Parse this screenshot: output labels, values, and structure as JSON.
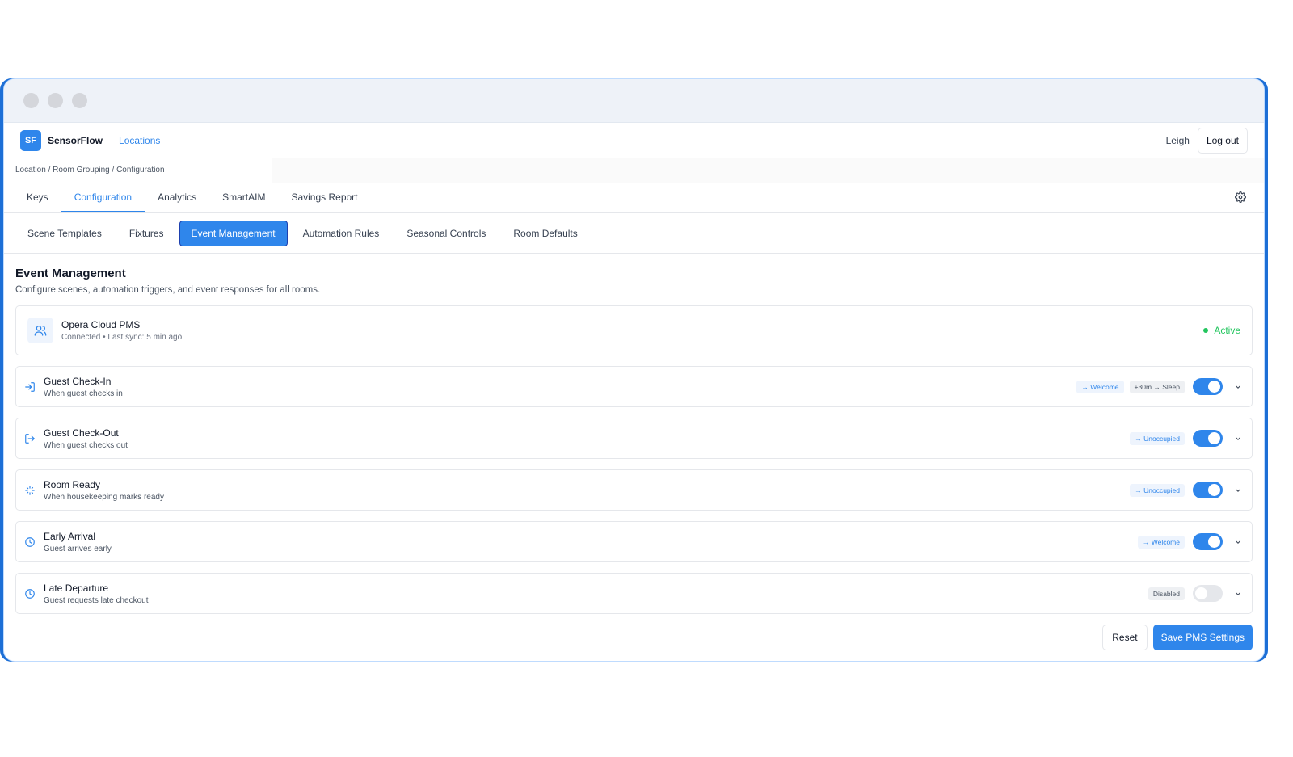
{
  "app": {
    "logo_text": "SF",
    "brand": "SensorFlow",
    "nav_link": "Locations",
    "user": "Leigh",
    "logout_label": "Log out"
  },
  "breadcrumb": "Location / Room Grouping / Configuration",
  "tabs": [
    {
      "label": "Keys",
      "active": false
    },
    {
      "label": "Configuration",
      "active": true
    },
    {
      "label": "Analytics",
      "active": false
    },
    {
      "label": "SmartAIM",
      "active": false
    },
    {
      "label": "Savings Report",
      "active": false
    }
  ],
  "subtabs": [
    {
      "label": "Scene Templates",
      "active": false
    },
    {
      "label": "Fixtures",
      "active": false
    },
    {
      "label": "Event Management",
      "active": true
    },
    {
      "label": "Automation Rules",
      "active": false
    },
    {
      "label": "Seasonal Controls",
      "active": false
    },
    {
      "label": "Room Defaults",
      "active": false
    }
  ],
  "page": {
    "title": "Event Management",
    "description": "Configure scenes, automation triggers, and event responses for all rooms."
  },
  "pms": {
    "name": "Opera Cloud PMS",
    "status_line": "Connected • Last sync: 5 min ago",
    "status": "Active"
  },
  "events": [
    {
      "name": "Guest Check-In",
      "desc": "When guest checks in",
      "icon": "check-in-icon",
      "badges": [
        {
          "text": "→ Welcome",
          "style": "blue"
        },
        {
          "text": "+30m → Sleep",
          "style": "grey"
        }
      ],
      "enabled": true
    },
    {
      "name": "Guest Check-Out",
      "desc": "When guest checks out",
      "icon": "check-out-icon",
      "badges": [
        {
          "text": "→ Unoccupied",
          "style": "blue"
        }
      ],
      "enabled": true
    },
    {
      "name": "Room Ready",
      "desc": "When housekeeping marks ready",
      "icon": "sparkle-icon",
      "badges": [
        {
          "text": "→ Unoccupied",
          "style": "blue"
        }
      ],
      "enabled": true
    },
    {
      "name": "Early Arrival",
      "desc": "Guest arrives early",
      "icon": "clock-icon",
      "badges": [
        {
          "text": "→ Welcome",
          "style": "blue"
        }
      ],
      "enabled": true
    },
    {
      "name": "Late Departure",
      "desc": "Guest requests late checkout",
      "icon": "clock-icon",
      "badges": [
        {
          "text": "Disabled",
          "style": "grey"
        }
      ],
      "enabled": false
    }
  ],
  "actions": {
    "reset": "Reset",
    "save": "Save PMS Settings"
  },
  "colors": {
    "accent": "#2f86eb",
    "active_status": "#22c55e"
  }
}
